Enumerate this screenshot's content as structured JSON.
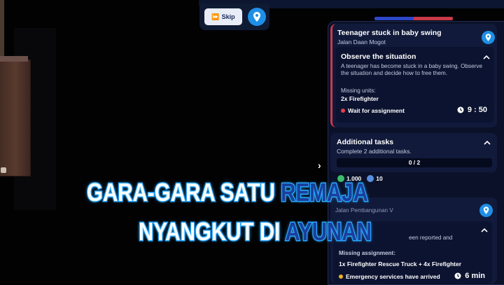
{
  "toolbar": {
    "skip_label": "Skip",
    "skip_icon": "fast-forward-icon",
    "location_icon": "map-pin-icon"
  },
  "mission": {
    "title": "Teenager stuck in baby swing",
    "location": "Jalan Daan Mogot",
    "task": {
      "title": "Observe the situation",
      "description": "A teenager has become stuck in a baby swing. Observe the situation and decide how to free them.",
      "missing_label": "Missing units:",
      "missing_units": "2x Firefighter",
      "status": "Wait for assignment",
      "status_color": "#e0404e",
      "timer": "9 : 50"
    }
  },
  "additional": {
    "title": "Additional tasks",
    "subtitle": "Complete 2 additional tasks.",
    "progress": "0 / 2",
    "reward_money": "1.000",
    "reward_xp": "10"
  },
  "mission2": {
    "location": "Jalan Pembangunan V",
    "description_fragment": "een reported and",
    "missing_label": "Missing assignment:",
    "missing_units": "1x Firefighter Rescue Truck + 4x Firefighter",
    "status": "Emergency services have arrived",
    "status_color": "#f0b020",
    "timer": "6 min"
  },
  "caption": {
    "line1_white": "GARA-GARA SATU ",
    "line1_blue": "REMAJA",
    "line2_white": "NYANGKUT DI ",
    "line2_blue": "AYUNAN"
  },
  "colors": {
    "accent": "#1e8fe6",
    "panel": "#0b1128",
    "card": "#111a3a",
    "caption_glow": "#2aa8ff"
  }
}
